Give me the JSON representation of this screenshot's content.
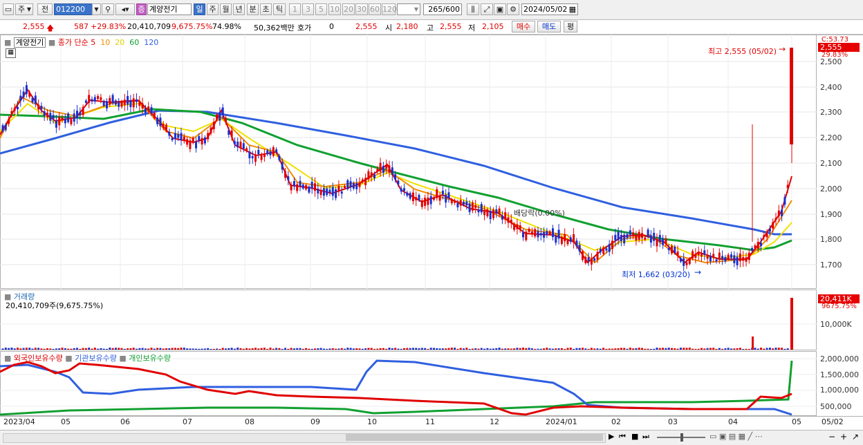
{
  "toolbar": {
    "market": "주",
    "prev": "전",
    "code": "012200",
    "type_badge": "증",
    "stock_name": "계양전기",
    "periods": [
      "일",
      "주",
      "월",
      "년",
      "분",
      "초",
      "틱"
    ],
    "intervals": [
      "1",
      "3",
      "5",
      "10",
      "20",
      "30",
      "60",
      "120"
    ],
    "count": "265",
    "count_max": "/600",
    "date": "2024/05/02"
  },
  "quote": {
    "price": "2,555",
    "change": "587",
    "change_pct": "+29.83%",
    "volume": "20,410,709",
    "volume_pct": "9,675.75%",
    "ratio": "74.98%",
    "amount": "50,362백만",
    "hoga_label": "호가",
    "hoga_value": "0",
    "hoga_price": "2,555",
    "open_label": "시",
    "open": "2,180",
    "high_label": "고",
    "high": "2,555",
    "low_label": "저",
    "low": "2,105",
    "buy_label": "매수",
    "sell_label": "매도",
    "eval_label": "평"
  },
  "price_pane": {
    "name_tag": "계양전기",
    "legend_prefix": "종가 단순",
    "ma_labels": [
      "5",
      "10",
      "20",
      "60",
      "120"
    ],
    "y_ticks": [
      "2,500",
      "2,400",
      "2,300",
      "2,200",
      "2,100",
      "2,000",
      "1,900",
      "1,800",
      "1,700"
    ],
    "current_tag": "2,555",
    "top_label": "C:53.73",
    "pct_label": "29.83%",
    "high_annot": "최고 2,555 (05/02)",
    "low_annot": "최저 1,662 (03/20)",
    "dividend_annot": "배당락(0.00%)"
  },
  "volume_pane": {
    "title": "거래량",
    "value": "20,410,709주(9,675.75%)",
    "tag": "20,411K",
    "tag_pct": "9675.75%",
    "y_tick": "10,000K"
  },
  "holdings_pane": {
    "legend": [
      "외국인보유수량",
      "기관보유수량",
      "개인보유수량"
    ],
    "y_ticks": [
      "2,000,000",
      "1,500,000",
      "1,000,000",
      "500,000"
    ]
  },
  "x_labels": [
    "2023/04",
    "05",
    "06",
    "07",
    "08",
    "09",
    "10",
    "11",
    "12",
    "2024/01",
    "02",
    "03",
    "04",
    "05",
    "05/02"
  ],
  "colors": {
    "up": "#e00000",
    "down": "#1a2fd0",
    "ma5": "#e00000",
    "ma10": "#f08c00",
    "ma20": "#f0e000",
    "ma60": "#10a030",
    "ma120": "#2f5fe0"
  }
}
